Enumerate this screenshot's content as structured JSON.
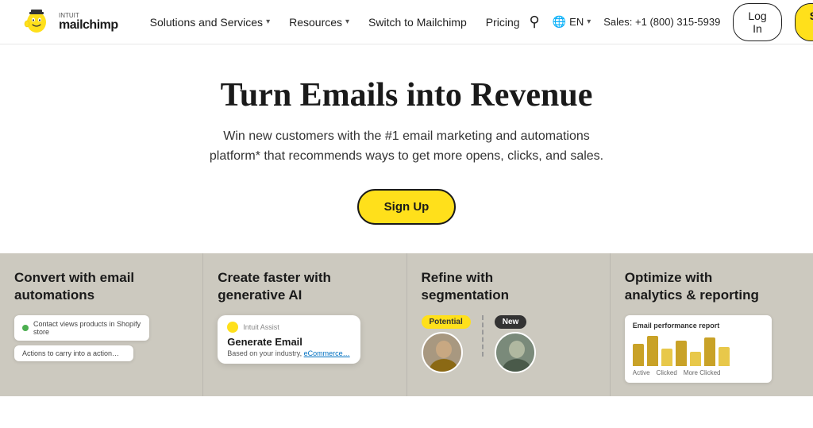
{
  "nav": {
    "logo_alt": "Intuit Mailchimp",
    "items": [
      {
        "label": "Solutions and Services",
        "has_chevron": true
      },
      {
        "label": "Resources",
        "has_chevron": true
      },
      {
        "label": "Switch to Mailchimp",
        "has_chevron": false
      },
      {
        "label": "Pricing",
        "has_chevron": false
      }
    ],
    "search_label": "Search",
    "lang_label": "EN",
    "sales_label": "Sales: +1 (800) 315-5939",
    "login_label": "Log In",
    "signup_label": "Sign Up"
  },
  "hero": {
    "title": "Turn Emails into Revenue",
    "subtitle": "Win new customers with the #1 email marketing and automations platform* that recommends ways to get more opens, clicks, and sales.",
    "cta_label": "Sign Up"
  },
  "cards": [
    {
      "id": "card-automations",
      "title": "Convert with email automations",
      "mock_line1": "Contact views products in Shopify store",
      "mock_line2": "Actions to carry into a action…"
    },
    {
      "id": "card-ai",
      "title": "Create faster with generative AI",
      "assist_label": "Intuit Assist",
      "bubble_title": "Generate Email",
      "bubble_sub": "Based on your industry, eCommerce…"
    },
    {
      "id": "card-segmentation",
      "title": "Refine with segmentation",
      "badge1": "Potential",
      "badge2": "New"
    },
    {
      "id": "card-analytics",
      "title": "Optimize with analytics & reporting",
      "report_title": "Email performance report",
      "stats": [
        "Active",
        "Clicked",
        "More Clicked"
      ]
    }
  ],
  "colors": {
    "yellow": "#ffe01b",
    "dark": "#1a1a1a",
    "card_bg": "#ccc9bf",
    "accent_green": "#4caf50"
  }
}
